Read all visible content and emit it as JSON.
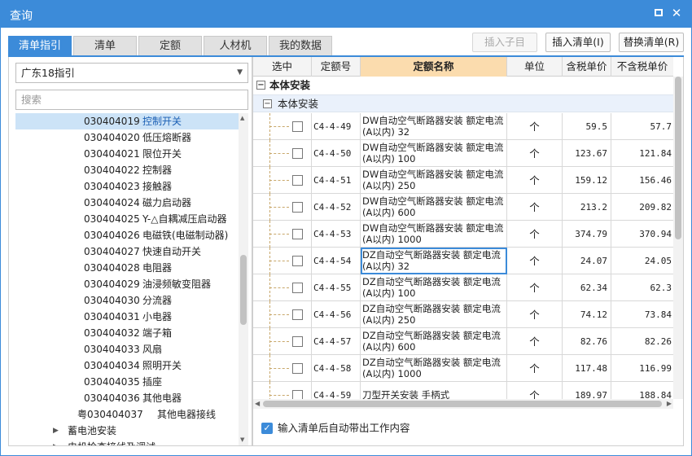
{
  "window": {
    "title": "查询"
  },
  "tabs": [
    {
      "label": "清单指引",
      "active": true
    },
    {
      "label": "清单",
      "active": false
    },
    {
      "label": "定额",
      "active": false
    },
    {
      "label": "人材机",
      "active": false
    },
    {
      "label": "我的数据",
      "active": false
    }
  ],
  "toolbar": {
    "insert_child": "插入子目",
    "insert_list": "插入清单(I)",
    "replace_list": "替换清单(R)"
  },
  "left": {
    "select_value": "广东18指引",
    "search_placeholder": "搜索",
    "tree": [
      {
        "code": "030404019",
        "name": "控制开关"
      },
      {
        "code": "030404020",
        "name": "低压熔断器"
      },
      {
        "code": "030404021",
        "name": "限位开关"
      },
      {
        "code": "030404022",
        "name": "控制器"
      },
      {
        "code": "030404023",
        "name": "接触器"
      },
      {
        "code": "030404024",
        "name": "磁力启动器"
      },
      {
        "code": "030404025",
        "name": "Y-△自耦减压启动器"
      },
      {
        "code": "030404026",
        "name": "电磁铁(电磁制动器)"
      },
      {
        "code": "030404027",
        "name": "快速自动开关"
      },
      {
        "code": "030404028",
        "name": "电阻器"
      },
      {
        "code": "030404029",
        "name": "油浸频敏变阻器"
      },
      {
        "code": "030404030",
        "name": "分流器"
      },
      {
        "code": "030404031",
        "name": "小电器"
      },
      {
        "code": "030404032",
        "name": "端子箱"
      },
      {
        "code": "030404033",
        "name": "风扇"
      },
      {
        "code": "030404034",
        "name": "照明开关"
      },
      {
        "code": "030404035",
        "name": "插座"
      },
      {
        "code": "030404036",
        "name": "其他电器"
      },
      {
        "code": "粤030404037",
        "name": "其他电器接线"
      }
    ],
    "group_label": "蓄电池安装",
    "cut_label": "电机检查接线及调试"
  },
  "grid": {
    "headers": {
      "select": "选中",
      "code": "定额号",
      "name": "定额名称",
      "unit": "单位",
      "tax": "含税单价",
      "notax": "不含税单价"
    },
    "group1": "本体安装",
    "group2": "本体安装",
    "rows": [
      {
        "code": "C4-4-49",
        "name": "DW自动空气断路器安装 额定电流(A以内) 32",
        "unit": "个",
        "tax": "59.5",
        "notax": "57.7"
      },
      {
        "code": "C4-4-50",
        "name": "DW自动空气断路器安装 额定电流(A以内) 100",
        "unit": "个",
        "tax": "123.67",
        "notax": "121.84"
      },
      {
        "code": "C4-4-51",
        "name": "DW自动空气断路器安装 额定电流(A以内) 250",
        "unit": "个",
        "tax": "159.12",
        "notax": "156.46"
      },
      {
        "code": "C4-4-52",
        "name": "DW自动空气断路器安装 额定电流(A以内) 600",
        "unit": "个",
        "tax": "213.2",
        "notax": "209.82"
      },
      {
        "code": "C4-4-53",
        "name": "DW自动空气断路器安装 额定电流(A以内) 1000",
        "unit": "个",
        "tax": "374.79",
        "notax": "370.94"
      },
      {
        "code": "C4-4-54",
        "name": "DZ自动空气断路器安装 额定电流(A以内) 32",
        "unit": "个",
        "tax": "24.07",
        "notax": "24.05"
      },
      {
        "code": "C4-4-55",
        "name": "DZ自动空气断路器安装 额定电流(A以内) 100",
        "unit": "个",
        "tax": "62.34",
        "notax": "62.3"
      },
      {
        "code": "C4-4-56",
        "name": "DZ自动空气断路器安装 额定电流(A以内) 250",
        "unit": "个",
        "tax": "74.12",
        "notax": "73.84"
      },
      {
        "code": "C4-4-57",
        "name": "DZ自动空气断路器安装 额定电流(A以内) 600",
        "unit": "个",
        "tax": "82.76",
        "notax": "82.26"
      },
      {
        "code": "C4-4-58",
        "name": "DZ自动空气断路器安装 额定电流(A以内) 1000",
        "unit": "个",
        "tax": "117.48",
        "notax": "116.99"
      },
      {
        "code": "C4-4-59",
        "name": "刀型开关安装 手柄式",
        "unit": "个",
        "tax": "189.97",
        "notax": "188.84"
      }
    ]
  },
  "footer": {
    "auto_work_content": "输入清单后自动带出工作内容",
    "checked": true
  },
  "colors": {
    "accent": "#3c8bd9",
    "header_highlight": "#fbdcae",
    "selected_row": "#cce3f7"
  }
}
